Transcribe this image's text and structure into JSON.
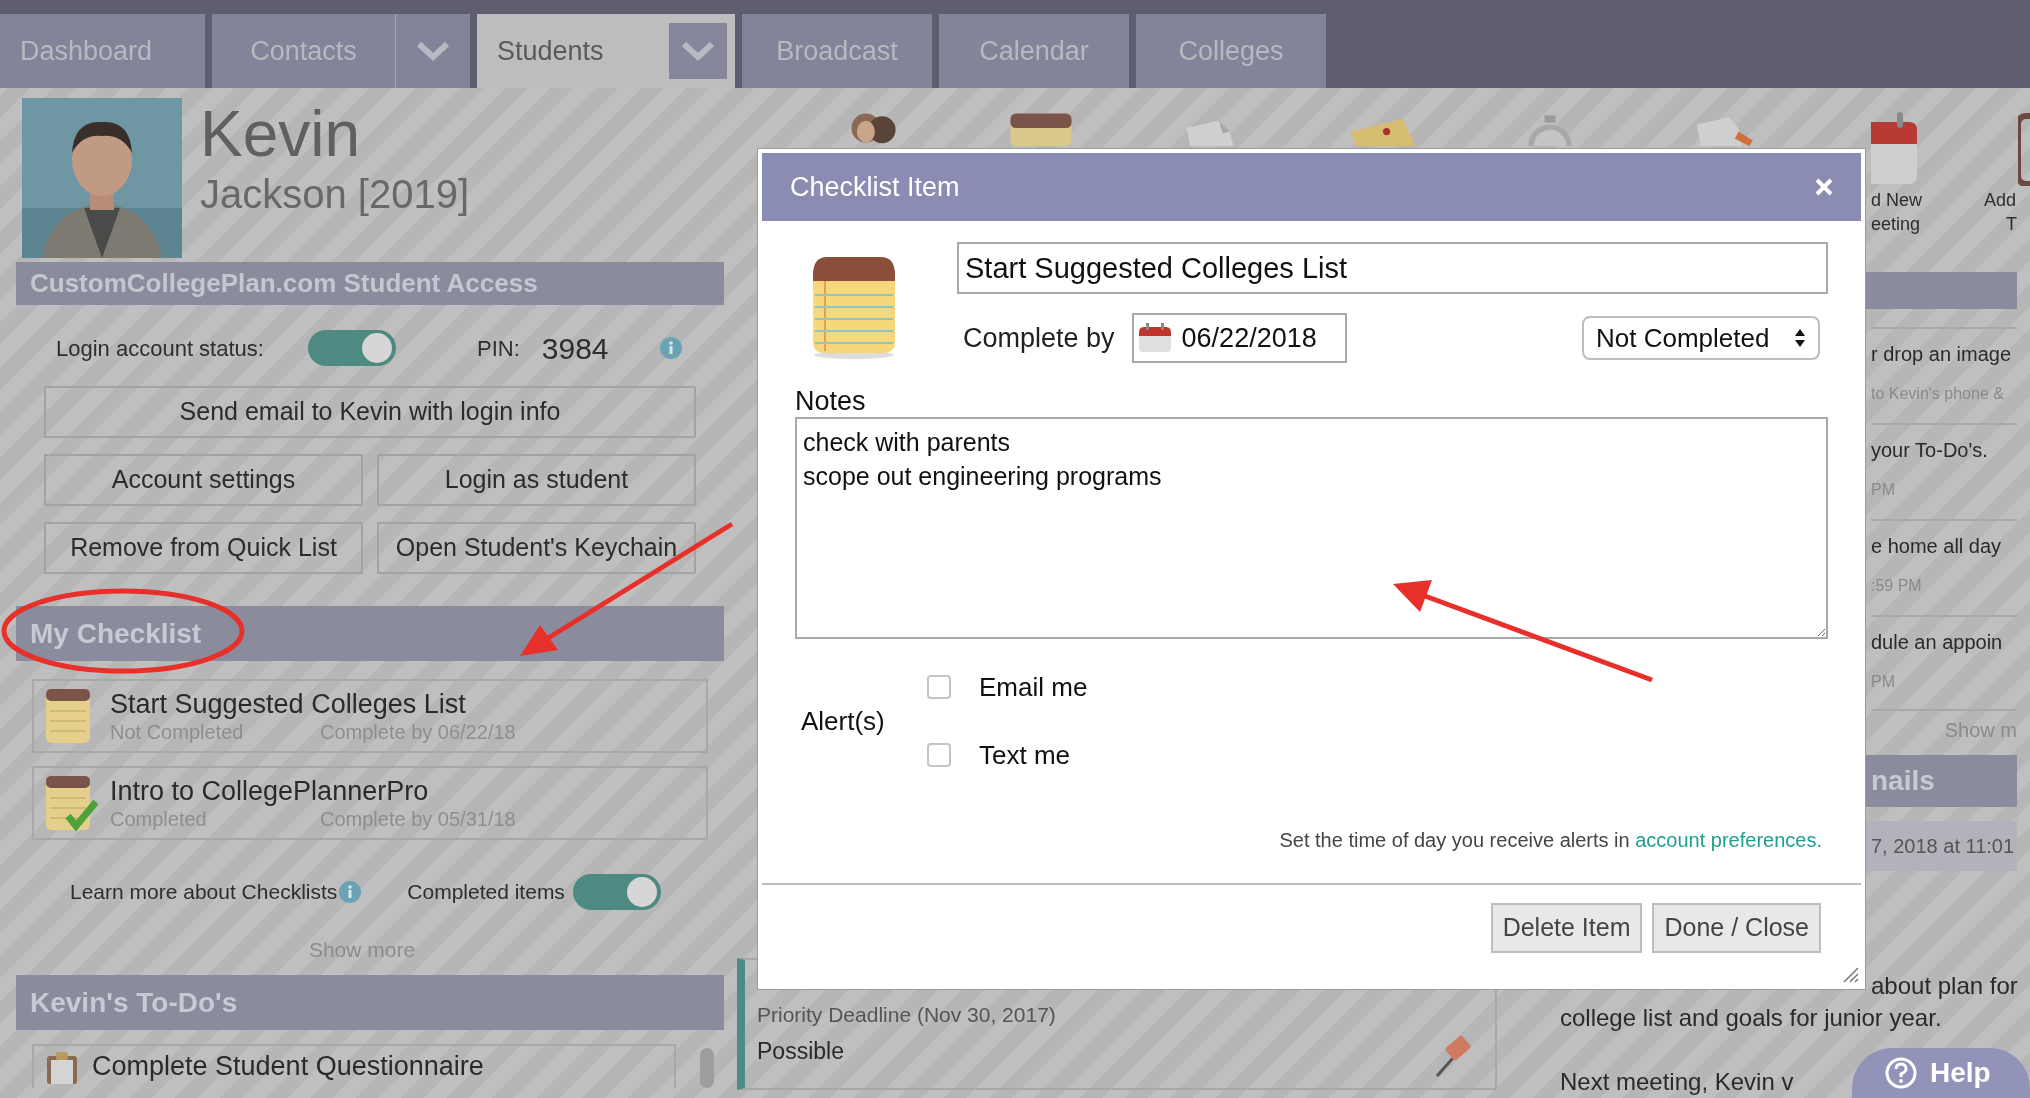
{
  "nav": {
    "tabs": [
      {
        "label": "Dashboard",
        "selected": false,
        "menu": false
      },
      {
        "label": "Contacts",
        "selected": false,
        "menu": true
      },
      {
        "label": "Students",
        "selected": true,
        "menu": true
      },
      {
        "label": "Broadcast",
        "selected": false,
        "menu": false
      },
      {
        "label": "Calendar",
        "selected": false,
        "menu": false
      },
      {
        "label": "Colleges",
        "selected": false,
        "menu": false
      }
    ]
  },
  "student": {
    "first_name": "Kevin",
    "last_name_year": "Jackson [2019]"
  },
  "access_panel": {
    "title": "CustomCollegePlan.com Student Access",
    "login_status_label": "Login account status:",
    "login_enabled": true,
    "pin_label": "PIN:",
    "pin": "3984",
    "buttons": [
      "Send email to Kevin with login info",
      "Account settings",
      "Login as student",
      "Remove from Quick List",
      "Open Student's Keychain"
    ]
  },
  "checklist_panel": {
    "title": "My Checklist",
    "items": [
      {
        "title": "Start Suggested Colleges List",
        "status": "Not Completed",
        "due": "Complete by 06/22/18",
        "completed": false
      },
      {
        "title": "Intro to CollegePlannerPro",
        "status": "Completed",
        "due": "Complete by 05/31/18",
        "completed": true
      }
    ],
    "learn_more": "Learn more about Checklists",
    "completed_items_label": "Completed items",
    "show_completed": true,
    "show_more": "Show more"
  },
  "todos_panel": {
    "title": "Kevin's To-Do's",
    "items": [
      "Complete Student Questionnaire"
    ]
  },
  "toolbar_captions": [
    {
      "lines": [
        "d New",
        "eeting"
      ]
    },
    {
      "lines": [
        "Add",
        "T"
      ]
    }
  ],
  "college_card": {
    "deadline": "Priority Deadline (Nov 30, 2017)",
    "status": "Possible"
  },
  "right_column": {
    "items": [
      {
        "kind": "big",
        "text": "r drop an image"
      },
      {
        "kind": "small",
        "text": "to Kevin's phone &"
      },
      {
        "kind": "big",
        "text": "your To-Do's."
      },
      {
        "kind": "small",
        "text": "PM"
      },
      {
        "kind": "big",
        "text": "e home all day"
      },
      {
        "kind": "small",
        "text": ":59 PM"
      },
      {
        "kind": "big",
        "text": "dule an appoin"
      },
      {
        "kind": "small",
        "text": "PM"
      },
      {
        "kind": "more",
        "text": "Show m"
      },
      {
        "kind": "header",
        "text": "nails"
      },
      {
        "kind": "date",
        "text": "7, 2018 at 11:01"
      }
    ],
    "note_lines": [
      "about plan for",
      "college list and goals for junior year.",
      "Next meeting, Kevin v"
    ]
  },
  "modal": {
    "title": "Checklist Item",
    "item_title": "Start Suggested Colleges List",
    "complete_by_label": "Complete by",
    "date": "06/22/2018",
    "status": "Not Completed",
    "notes_label": "Notes",
    "notes": "check with parents\nscope out engineering programs",
    "alerts_label": "Alert(s)",
    "alerts": [
      {
        "label": "Email me",
        "checked": false
      },
      {
        "label": "Text me",
        "checked": false
      }
    ],
    "alert_hint": "Set the time of day you receive alerts in ",
    "alert_link": "account preferences.",
    "buttons": [
      "Delete Item",
      "Done / Close"
    ]
  },
  "help_button": {
    "label": "Help"
  }
}
